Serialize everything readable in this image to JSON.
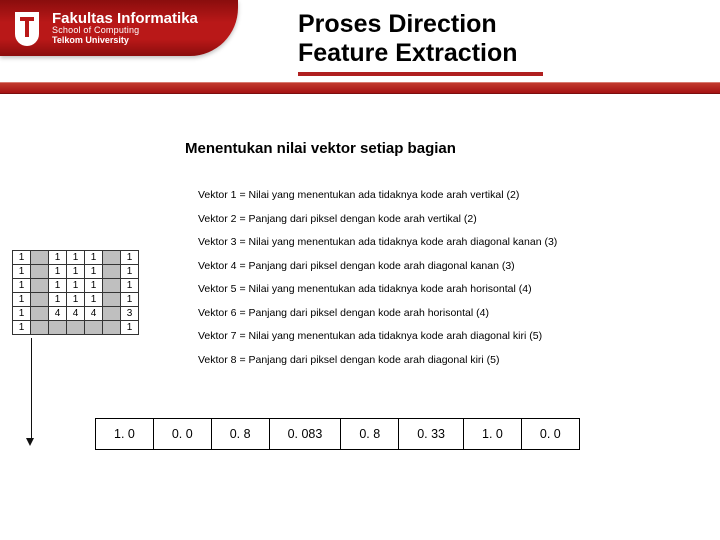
{
  "brand": {
    "line1": "Fakultas Informatika",
    "line2": "School of Computing",
    "line3": "Telkom University"
  },
  "title_l1": "Proses Direction",
  "title_l2": "Feature Extraction",
  "subtitle": "Menentukan nilai vektor setiap bagian",
  "vectors": [
    "Vektor 1 = Nilai yang menentukan ada tidaknya kode arah vertikal (2)",
    "Vektor 2 = Panjang dari piksel dengan kode arah vertikal (2)",
    "Vektor 3 = Nilai yang menentukan ada tidaknya kode arah diagonal kanan (3)",
    "Vektor 4 = Panjang dari piksel dengan kode arah diagonal kanan (3)",
    "Vektor 5 = Nilai yang menentukan ada tidaknya kode arah horisontal (4)",
    "Vektor 6 = Panjang dari piksel dengan kode arah horisontal (4)",
    "Vektor 7 = Nilai yang menentukan ada tidaknya kode arah diagonal kiri (5)",
    "Vektor 8 = Panjang dari piksel dengan kode arah diagonal kiri (5)"
  ],
  "grid": [
    [
      "1",
      "",
      "1",
      "1",
      "1",
      "",
      "1"
    ],
    [
      "1",
      "",
      "1",
      "1",
      "1",
      "",
      "1"
    ],
    [
      "1",
      "",
      "1",
      "1",
      "1",
      "",
      "1"
    ],
    [
      "1",
      "",
      "1",
      "1",
      "1",
      "",
      "1"
    ],
    [
      "1",
      "",
      "4",
      "4",
      "4",
      "",
      "3"
    ],
    [
      "1",
      "",
      "",
      "",
      "",
      "",
      "1"
    ]
  ],
  "grid_grey": [
    [
      0,
      1,
      0,
      0,
      0,
      1,
      0
    ],
    [
      0,
      1,
      0,
      0,
      0,
      1,
      0
    ],
    [
      0,
      1,
      0,
      0,
      0,
      1,
      0
    ],
    [
      0,
      1,
      0,
      0,
      0,
      1,
      0
    ],
    [
      0,
      1,
      0,
      0,
      0,
      1,
      0
    ],
    [
      0,
      1,
      1,
      1,
      1,
      1,
      0
    ]
  ],
  "values": [
    "1. 0",
    "0. 0",
    "0. 8",
    "0. 083",
    "0. 8",
    "0. 33",
    "1. 0",
    "0. 0"
  ]
}
